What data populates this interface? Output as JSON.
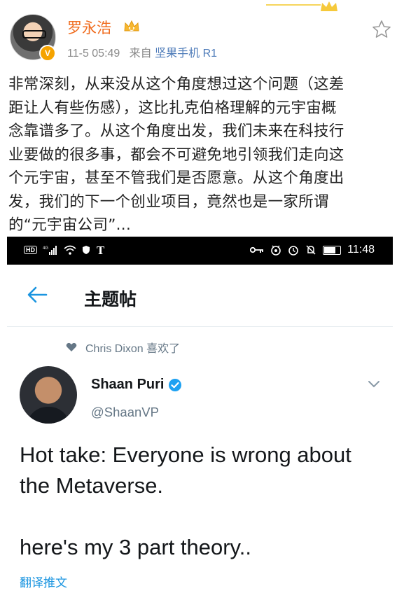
{
  "weibo": {
    "username": "罗永浩",
    "verified_badge": "V",
    "time": "11-5 05:49",
    "source_prefix": "来自",
    "device": "坚果手机 R1",
    "post_lines": [
      "非常深刻，从来没从这个角度想过这个问题（这差",
      "距让人有些伤感），这比扎克伯格理解的元宇宙概",
      "念靠谱多了。从这个角度出发，我们未来在科技行",
      "业要做的很多事，都会不可避免地引领我们走向这",
      "个元宇宙，甚至不管我们是否愿意。从这个角度出",
      "发，我们的下一个创业项目，竟然也是一家所谓",
      "的“元宇宙公司”..."
    ],
    "colors": {
      "username": "#f06d20",
      "device": "#4c7ab8",
      "meta": "#8a8a8a"
    }
  },
  "status_bar": {
    "left_text": "HD",
    "signal_text": "4G",
    "time": "11:48"
  },
  "twitter": {
    "header_title": "主题帖",
    "liked_by": "Chris Dixon 喜欢了",
    "author_name": "Shaan Puri",
    "author_handle": "@ShaanVP",
    "tweet_lines": [
      "Hot take: Everyone is wrong about",
      "the Metaverse.",
      "",
      "here's my 3 part theory.."
    ],
    "translate_label": "翻译推文",
    "colors": {
      "link": "#1b95e0",
      "secondary": "#657786",
      "verified": "#1da1f2"
    }
  }
}
